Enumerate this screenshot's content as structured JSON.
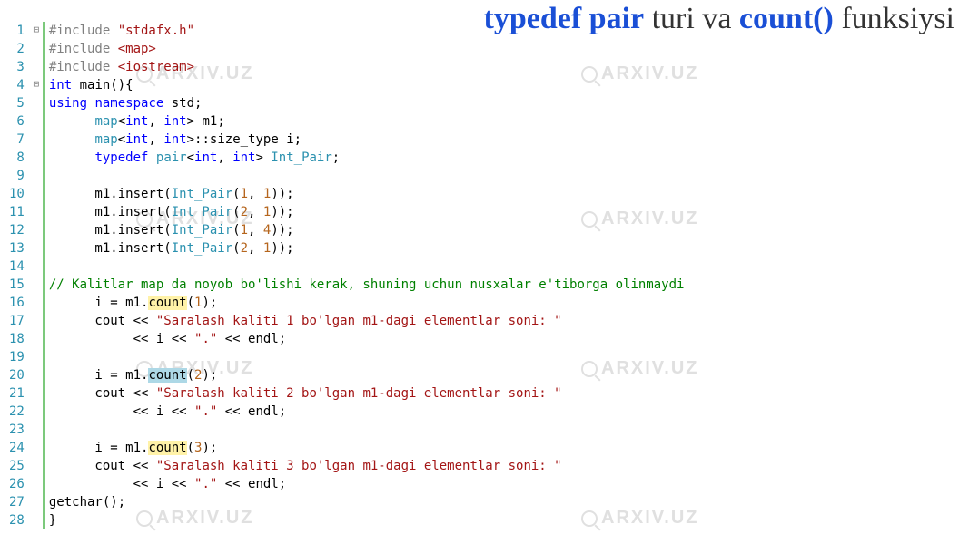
{
  "title": {
    "part1": "typedef pair",
    "part2": " turi va ",
    "part3": "count()",
    "part4": " funksiysi"
  },
  "watermark_text": "ARXIV.UZ",
  "code": {
    "lines": [
      {
        "n": 1,
        "fold": "⊟",
        "segs": [
          [
            "prep",
            "#include "
          ],
          [
            "str",
            "\"stdafx.h\""
          ]
        ]
      },
      {
        "n": 2,
        "fold": "│",
        "segs": [
          [
            "prep",
            "#include "
          ],
          [
            "str",
            "<map>"
          ]
        ]
      },
      {
        "n": 3,
        "fold": "│",
        "segs": [
          [
            "prep",
            "#include "
          ],
          [
            "str",
            "<iostream>"
          ]
        ]
      },
      {
        "n": 4,
        "fold": "⊟",
        "segs": [
          [
            "kw",
            "int"
          ],
          [
            "",
            " main(){"
          ]
        ]
      },
      {
        "n": 5,
        "fold": "│",
        "segs": [
          [
            "kw",
            "using"
          ],
          [
            "",
            " "
          ],
          [
            "kw",
            "namespace"
          ],
          [
            "",
            " std;"
          ]
        ]
      },
      {
        "n": 6,
        "fold": "│",
        "segs": [
          [
            "",
            "      "
          ],
          [
            "type",
            "map"
          ],
          [
            "",
            "<"
          ],
          [
            "kw",
            "int"
          ],
          [
            "",
            ", "
          ],
          [
            "kw",
            "int"
          ],
          [
            "",
            "> m1;"
          ]
        ]
      },
      {
        "n": 7,
        "fold": "│",
        "segs": [
          [
            "",
            "      "
          ],
          [
            "type",
            "map"
          ],
          [
            "",
            "<"
          ],
          [
            "kw",
            "int"
          ],
          [
            "",
            ", "
          ],
          [
            "kw",
            "int"
          ],
          [
            "",
            ">::size_type i;"
          ]
        ]
      },
      {
        "n": 8,
        "fold": "│",
        "segs": [
          [
            "",
            "      "
          ],
          [
            "kw",
            "typedef"
          ],
          [
            "",
            " "
          ],
          [
            "type",
            "pair"
          ],
          [
            "",
            "<"
          ],
          [
            "kw",
            "int"
          ],
          [
            "",
            ", "
          ],
          [
            "kw",
            "int"
          ],
          [
            "",
            "> "
          ],
          [
            "type",
            "Int_Pair"
          ],
          [
            "",
            ";"
          ]
        ]
      },
      {
        "n": 9,
        "fold": "│",
        "segs": [
          [
            "",
            ""
          ]
        ]
      },
      {
        "n": 10,
        "fold": "│",
        "segs": [
          [
            "",
            "      m1.insert("
          ],
          [
            "type",
            "Int_Pair"
          ],
          [
            "",
            "("
          ],
          [
            "num",
            "1"
          ],
          [
            "",
            ", "
          ],
          [
            "num",
            "1"
          ],
          [
            "",
            "));"
          ]
        ]
      },
      {
        "n": 11,
        "fold": "│",
        "segs": [
          [
            "",
            "      m1.insert("
          ],
          [
            "type",
            "Int_Pair"
          ],
          [
            "",
            "("
          ],
          [
            "num",
            "2"
          ],
          [
            "",
            ", "
          ],
          [
            "num",
            "1"
          ],
          [
            "",
            "));"
          ]
        ]
      },
      {
        "n": 12,
        "fold": "│",
        "segs": [
          [
            "",
            "      m1.insert("
          ],
          [
            "type",
            "Int_Pair"
          ],
          [
            "",
            "("
          ],
          [
            "num",
            "1"
          ],
          [
            "",
            ", "
          ],
          [
            "num",
            "4"
          ],
          [
            "",
            "));"
          ]
        ]
      },
      {
        "n": 13,
        "fold": "│",
        "segs": [
          [
            "",
            "      m1.insert("
          ],
          [
            "type",
            "Int_Pair"
          ],
          [
            "",
            "("
          ],
          [
            "num",
            "2"
          ],
          [
            "",
            ", "
          ],
          [
            "num",
            "1"
          ],
          [
            "",
            "));"
          ]
        ]
      },
      {
        "n": 14,
        "fold": "│",
        "segs": [
          [
            "",
            ""
          ]
        ]
      },
      {
        "n": 15,
        "fold": "│",
        "segs": [
          [
            "cmt",
            "// Kalitlar map da noyob bo'lishi kerak, shuning uchun nusxalar e'tiborga olinmaydi"
          ]
        ]
      },
      {
        "n": 16,
        "fold": "│",
        "segs": [
          [
            "",
            "      i = m1."
          ],
          [
            "hl",
            "count"
          ],
          [
            "",
            "("
          ],
          [
            "num",
            "1"
          ],
          [
            "",
            ");"
          ]
        ]
      },
      {
        "n": 17,
        "fold": "│",
        "segs": [
          [
            "",
            "      cout << "
          ],
          [
            "str",
            "\"Saralash kaliti 1 bo'lgan m1-dagi elementlar soni: \""
          ]
        ]
      },
      {
        "n": 18,
        "fold": "│",
        "segs": [
          [
            "",
            "           << i << "
          ],
          [
            "str",
            "\".\""
          ],
          [
            "",
            " << endl;"
          ]
        ]
      },
      {
        "n": 19,
        "fold": "│",
        "segs": [
          [
            "",
            ""
          ]
        ]
      },
      {
        "n": 20,
        "fold": "│",
        "segs": [
          [
            "",
            "      i = m1."
          ],
          [
            "sel",
            "count"
          ],
          [
            "",
            "("
          ],
          [
            "num",
            "2"
          ],
          [
            "",
            ");"
          ]
        ]
      },
      {
        "n": 21,
        "fold": "│",
        "segs": [
          [
            "",
            "      cout << "
          ],
          [
            "str",
            "\"Saralash kaliti 2 bo'lgan m1-dagi elementlar soni: \""
          ]
        ]
      },
      {
        "n": 22,
        "fold": "│",
        "segs": [
          [
            "",
            "           << i << "
          ],
          [
            "str",
            "\".\""
          ],
          [
            "",
            " << endl;"
          ]
        ]
      },
      {
        "n": 23,
        "fold": "│",
        "segs": [
          [
            "",
            ""
          ]
        ]
      },
      {
        "n": 24,
        "fold": "│",
        "segs": [
          [
            "",
            "      i = m1."
          ],
          [
            "hl",
            "count"
          ],
          [
            "",
            "("
          ],
          [
            "num",
            "3"
          ],
          [
            "",
            ");"
          ]
        ]
      },
      {
        "n": 25,
        "fold": "│",
        "segs": [
          [
            "",
            "      cout << "
          ],
          [
            "str",
            "\"Saralash kaliti 3 bo'lgan m1-dagi elementlar soni: \""
          ]
        ]
      },
      {
        "n": 26,
        "fold": "│",
        "segs": [
          [
            "",
            "           << i << "
          ],
          [
            "str",
            "\".\""
          ],
          [
            "",
            " << endl;"
          ]
        ]
      },
      {
        "n": 27,
        "fold": "│",
        "segs": [
          [
            "",
            "getchar();"
          ]
        ]
      },
      {
        "n": 28,
        "fold": "└",
        "segs": [
          [
            "",
            "}"
          ]
        ]
      }
    ]
  }
}
